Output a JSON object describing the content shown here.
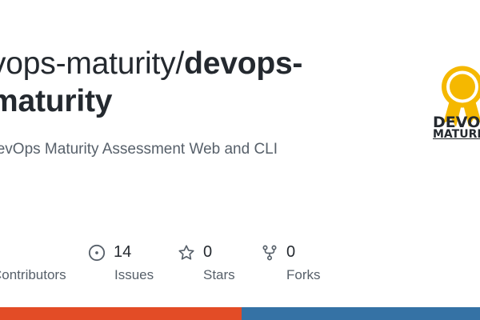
{
  "repo": {
    "owner": "devops-maturity/",
    "name": "devops-",
    "name_cont": "aturity",
    "owner_prefix": "v",
    "description": "Ops Maturity Assessment Web and CLI"
  },
  "stats": {
    "contributors": {
      "label": "Contributors",
      "icon": "people-icon"
    },
    "issues": {
      "value": "14",
      "label": "Issues",
      "icon": "issue-icon"
    },
    "stars": {
      "value": "0",
      "label": "Stars",
      "icon": "star-icon"
    },
    "forks": {
      "value": "0",
      "label": "Forks",
      "icon": "fork-icon"
    }
  },
  "logo": {
    "line1": "DEVOP",
    "line2": "MATURITY",
    "icon": "award-ribbon-icon",
    "color": "#f5b800"
  },
  "language_bar": [
    {
      "color": "#e34c26",
      "fraction": 0.5
    },
    {
      "color": "#3572a5",
      "fraction": 0.5
    }
  ]
}
